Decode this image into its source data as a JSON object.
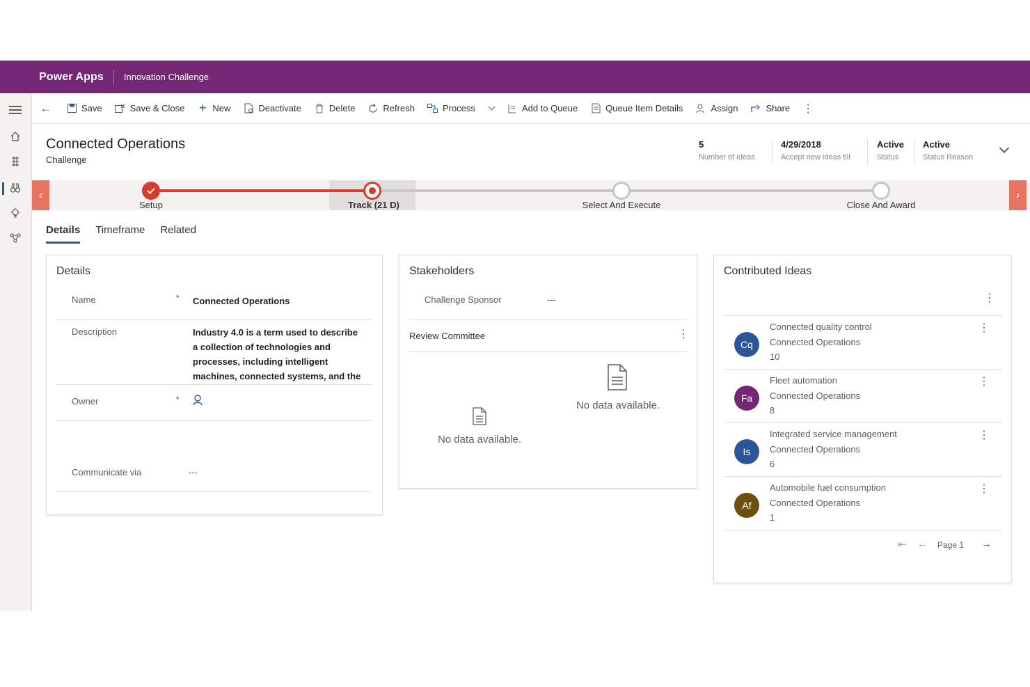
{
  "app": {
    "brand": "Power Apps",
    "app_name": "Innovation Challenge",
    "accent_color": "#742774"
  },
  "command_bar": {
    "items": [
      {
        "label": "Save",
        "icon": "save-icon"
      },
      {
        "label": "Save & Close",
        "icon": "save-close-icon"
      },
      {
        "label": "New",
        "icon": "plus-icon"
      },
      {
        "label": "Deactivate",
        "icon": "deactivate-icon"
      },
      {
        "label": "Delete",
        "icon": "delete-icon"
      },
      {
        "label": "Refresh",
        "icon": "refresh-icon"
      },
      {
        "label": "Process",
        "icon": "process-icon"
      },
      {
        "label": "Add to Queue",
        "icon": "add-to-queue-icon"
      },
      {
        "label": "Queue Item Details",
        "icon": "queue-details-icon"
      },
      {
        "label": "Assign",
        "icon": "assign-icon"
      },
      {
        "label": "Share",
        "icon": "share-icon"
      }
    ]
  },
  "record": {
    "title": "Connected Operations",
    "entity": "Challenge",
    "header_fields": [
      {
        "value": "5",
        "label": "Number of ideas"
      },
      {
        "value": "4/29/2018",
        "label": "Accept new ideas till"
      },
      {
        "value": "Active",
        "label": "Status"
      },
      {
        "value": "Active",
        "label": "Status Reason"
      }
    ]
  },
  "process": {
    "stages": [
      {
        "label": "Setup",
        "state": "completed"
      },
      {
        "label": "Track  (21 D)",
        "state": "active"
      },
      {
        "label": "Select And Execute",
        "state": "pending"
      },
      {
        "label": "Close And Award",
        "state": "pending"
      }
    ],
    "completed_color": "#d83b2b"
  },
  "tabs": [
    "Details",
    "Timeframe",
    "Related"
  ],
  "details": {
    "title": "Details",
    "name_label": "Name",
    "name_value": "Connected Operations",
    "description_label": "Description",
    "description_lines": [
      "Industry 4.0 is a term used to describe",
      "a collection of technologies and",
      "processes, including intelligent",
      "machines, connected systems, and the"
    ],
    "owner_label": "Owner",
    "communicate_label": "Communicate via",
    "communicate_value": "---",
    "required_mark": "*"
  },
  "stakeholders": {
    "title": "Stakeholders",
    "sponsor_label": "Challenge Sponsor",
    "sponsor_value": "---",
    "committee_label": "Review Committee",
    "no_data_left": "No data available.",
    "no_data_right": "No data available."
  },
  "ideas": {
    "title": "Contributed Ideas",
    "items": [
      {
        "initials": "Cq",
        "name": "Connected quality control",
        "challenge": "Connected Operations",
        "count": "10",
        "color": "#2b579a"
      },
      {
        "initials": "Fa",
        "name": "Fleet automation",
        "challenge": "Connected Operations",
        "count": "8",
        "color": "#742774"
      },
      {
        "initials": "Is",
        "name": "Integrated service management",
        "challenge": "Connected Operations",
        "count": "6",
        "color": "#2b579a"
      },
      {
        "initials": "Af",
        "name": "Automobile fuel consumption",
        "challenge": "Connected Operations",
        "count": "1",
        "color": "#6b4f0f"
      }
    ],
    "page_label": "Page 1"
  }
}
